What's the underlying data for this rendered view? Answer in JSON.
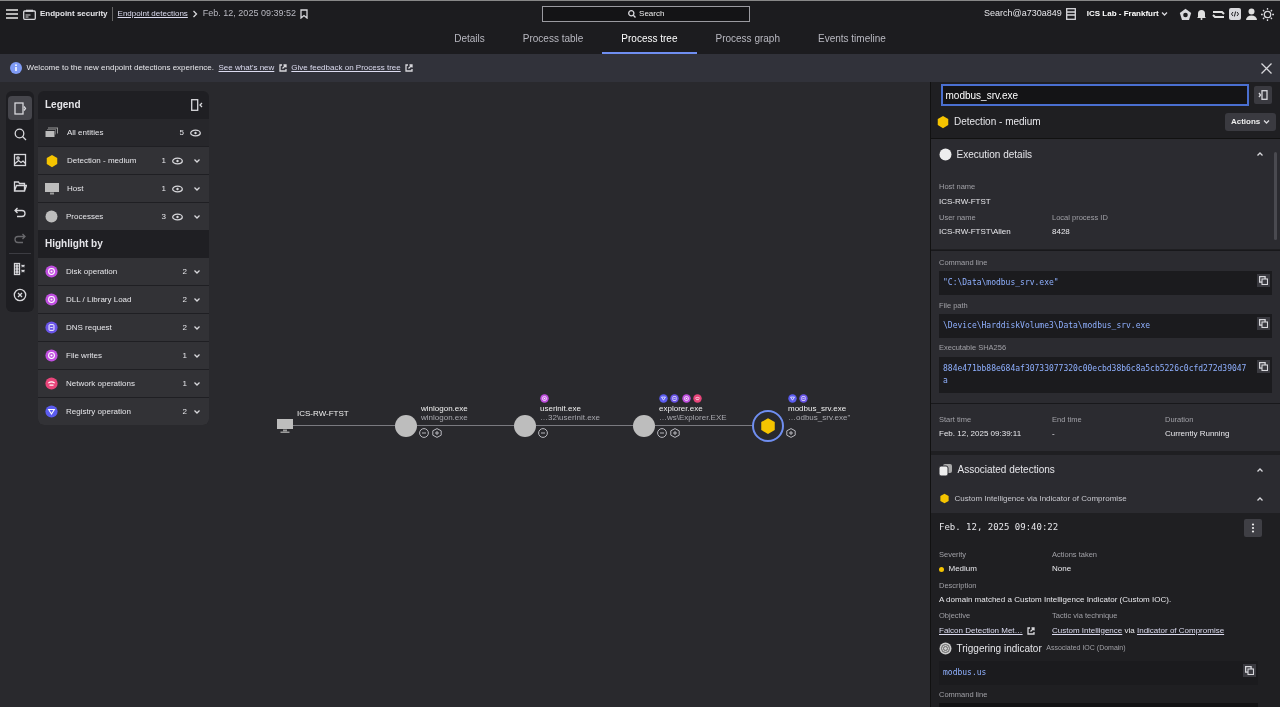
{
  "header": {
    "app": "Endpoint security",
    "breadcrumb": "Endpoint detections",
    "date": "Feb. 12, 2025 09:39:52",
    "search": "Search",
    "user": "Search@a730a849",
    "tenant": "ICS Lab - Frankfurt"
  },
  "tabs": [
    {
      "label": "Details",
      "selected": false
    },
    {
      "label": "Process table",
      "selected": false
    },
    {
      "label": "Process tree",
      "selected": true
    },
    {
      "label": "Process graph",
      "selected": false
    },
    {
      "label": "Events timeline",
      "selected": false
    }
  ],
  "banner": {
    "text": "Welcome to the new endpoint detections experience.",
    "links": [
      "See what's new",
      "Give feedback on Process tree"
    ]
  },
  "tools": [
    {
      "kind": "panel",
      "selected": true,
      "disabled": false
    },
    {
      "kind": "search",
      "selected": false,
      "disabled": false
    },
    {
      "kind": "image",
      "selected": false,
      "disabled": false
    },
    {
      "kind": "folder",
      "selected": false,
      "disabled": false
    },
    {
      "kind": "undo",
      "selected": false,
      "disabled": false
    },
    {
      "kind": "redo",
      "selected": false,
      "disabled": true
    },
    {
      "kind": "grid",
      "selected": false,
      "disabled": false
    },
    {
      "kind": "clear",
      "selected": false,
      "disabled": false
    }
  ],
  "legend": {
    "title": "Legend",
    "all": {
      "label": "All entities",
      "count": "5",
      "visible": true
    },
    "entities": [
      {
        "kind": "detection",
        "label": "Detection - medium",
        "count": "1",
        "visible": true,
        "expanded": false
      },
      {
        "kind": "host",
        "label": "Host",
        "count": "1",
        "visible": true,
        "expanded": false
      },
      {
        "kind": "process",
        "label": "Processes",
        "count": "3",
        "visible": true,
        "expanded": false
      }
    ],
    "highlight_title": "Highlight by",
    "highlights": [
      {
        "kind": "disk",
        "label": "Disk operation",
        "count": "2",
        "color": "#c04fe0",
        "expanded": false
      },
      {
        "kind": "dll",
        "label": "DLL / Library Load",
        "count": "2",
        "color": "#c04fe0",
        "expanded": false
      },
      {
        "kind": "dns",
        "label": "DNS request",
        "count": "2",
        "color": "#6a55e8",
        "expanded": false
      },
      {
        "kind": "file",
        "label": "File writes",
        "count": "1",
        "color": "#c04fe0",
        "expanded": false
      },
      {
        "kind": "network",
        "label": "Network operations",
        "count": "1",
        "color": "#e8457a",
        "expanded": false
      },
      {
        "kind": "registry",
        "label": "Registry operation",
        "count": "2",
        "color": "#5b5cf0",
        "expanded": false
      }
    ]
  },
  "tree": [
    {
      "kind": "host",
      "name": "ICS-RW-FTST",
      "selected": false,
      "can_collapse": false,
      "can_expand": false
    },
    {
      "kind": "process",
      "name": "winlogon.exe",
      "path": "winlogon.exe",
      "selected": false,
      "can_collapse": true,
      "can_expand": true
    },
    {
      "kind": "process",
      "name": "userinit.exe",
      "path": "…32\\userinit.exe",
      "selected": false,
      "badges": [
        {
          "kind": "disk",
          "color": "#c04fe0"
        }
      ],
      "can_collapse": true,
      "can_expand": false
    },
    {
      "kind": "process",
      "name": "explorer.exe",
      "path": "…ws\\Explorer.EXE",
      "selected": false,
      "badges": [
        {
          "kind": "registry",
          "color": "#5b5cf0"
        },
        {
          "kind": "dns",
          "color": "#6a55e8"
        },
        {
          "kind": "disk",
          "color": "#c04fe0"
        },
        {
          "kind": "network",
          "color": "#e8457a"
        }
      ],
      "can_collapse": true,
      "can_expand": true
    },
    {
      "kind": "detection",
      "name": "modbus_srv.exe",
      "path": "…odbus_srv.exe\"",
      "selected": true,
      "badges": [
        {
          "kind": "registry",
          "color": "#5b5cf0"
        },
        {
          "kind": "dns",
          "color": "#6a55e8"
        }
      ],
      "can_collapse": false,
      "can_expand": true
    }
  ],
  "details": {
    "search": {
      "value": "modbus_srv.exe"
    },
    "heading": "Detection - medium",
    "actions": "Actions",
    "execution": {
      "title": "Execution details",
      "expanded": true,
      "info_rows": [
        [
          {
            "label": "Host name",
            "value": "ICS-RW-FTST"
          }
        ],
        [
          {
            "label": "User name",
            "value": "ICS-RW-FTST\\Allen"
          },
          {
            "label": "Local process ID",
            "value": "8428"
          }
        ]
      ],
      "code_fields": [
        {
          "label": "Command line",
          "value": "\"C:\\Data\\modbus_srv.exe\""
        },
        {
          "label": "File path",
          "value": "\\Device\\HarddiskVolume3\\Data\\modbus_srv.exe"
        },
        {
          "label": "Executable SHA256",
          "value": "884e471bb88e684af30733077320c00ecbd38b6c8a5cb5226c0cfd272d39047a"
        }
      ],
      "time_row": [
        {
          "label": "Start time",
          "value": "Feb. 12, 2025 09:39:11"
        },
        {
          "label": "End time",
          "value": "-"
        },
        {
          "label": "Duration",
          "value": "Currently Running"
        }
      ]
    },
    "associated": {
      "title": "Associated detections",
      "expanded": true,
      "detection": {
        "title": "Custom Intelligence via Indicator of Compromise",
        "expanded": true,
        "timestamp": "Feb. 12, 2025 09:40:22",
        "severity": {
          "label": "Severity",
          "value": "Medium",
          "color": "#f5c400"
        },
        "actions_taken": {
          "label": "Actions taken",
          "value": "None"
        },
        "description": {
          "label": "Description",
          "value": "A domain matched a Custom Intelligence Indicator (Custom IOC)."
        },
        "objective": {
          "label": "Objective",
          "link": "Falcon Detection Met…"
        },
        "tactic": {
          "label": "Tactic via technique",
          "parts": [
            {
              "kind": "link",
              "text": "Custom Intelligence"
            },
            {
              "kind": "text",
              "text": "via"
            },
            {
              "kind": "link",
              "text": "Indicator of Compromise"
            }
          ]
        },
        "indicator": {
          "title": "Triggering indicator",
          "subtitle": "Associated IOC (Domain)",
          "value": "modbus.us"
        },
        "next_label": "Command line"
      }
    }
  }
}
